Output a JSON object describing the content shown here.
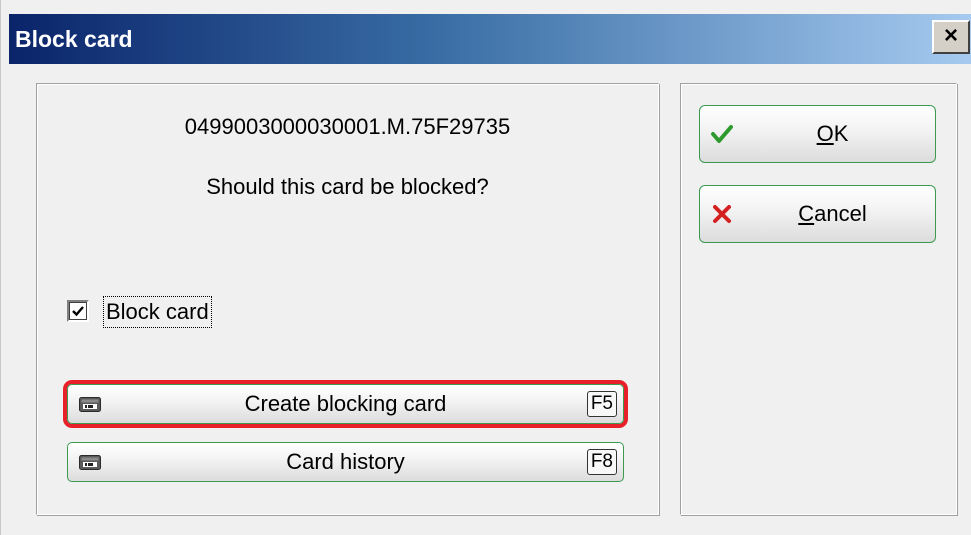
{
  "window": {
    "title": "Block card",
    "close_glyph": "×"
  },
  "main": {
    "card_id": "0499003000030001.M.75F29735",
    "question": "Should this card be blocked?",
    "block_checkbox": {
      "label": "Block card",
      "checked": true
    },
    "buttons": [
      {
        "label": "Create blocking card",
        "shortcut": "F5",
        "icon": "card-id-icon",
        "highlighted": true
      },
      {
        "label": "Card history",
        "shortcut": "F8",
        "icon": "card-id-icon",
        "highlighted": false
      }
    ]
  },
  "actions": {
    "ok": {
      "mnemonic": "O",
      "rest": "K",
      "icon": "green-checkmark-icon"
    },
    "cancel": {
      "mnemonic": "C",
      "rest": "ancel",
      "icon": "red-x-icon"
    }
  },
  "colors": {
    "title_gradient_start": "#0a246a",
    "title_gradient_end": "#a6caf0",
    "button_border": "#3a9b50",
    "highlight": "#e8202a",
    "check_green": "#2e9a2e",
    "cancel_red": "#d42020"
  }
}
